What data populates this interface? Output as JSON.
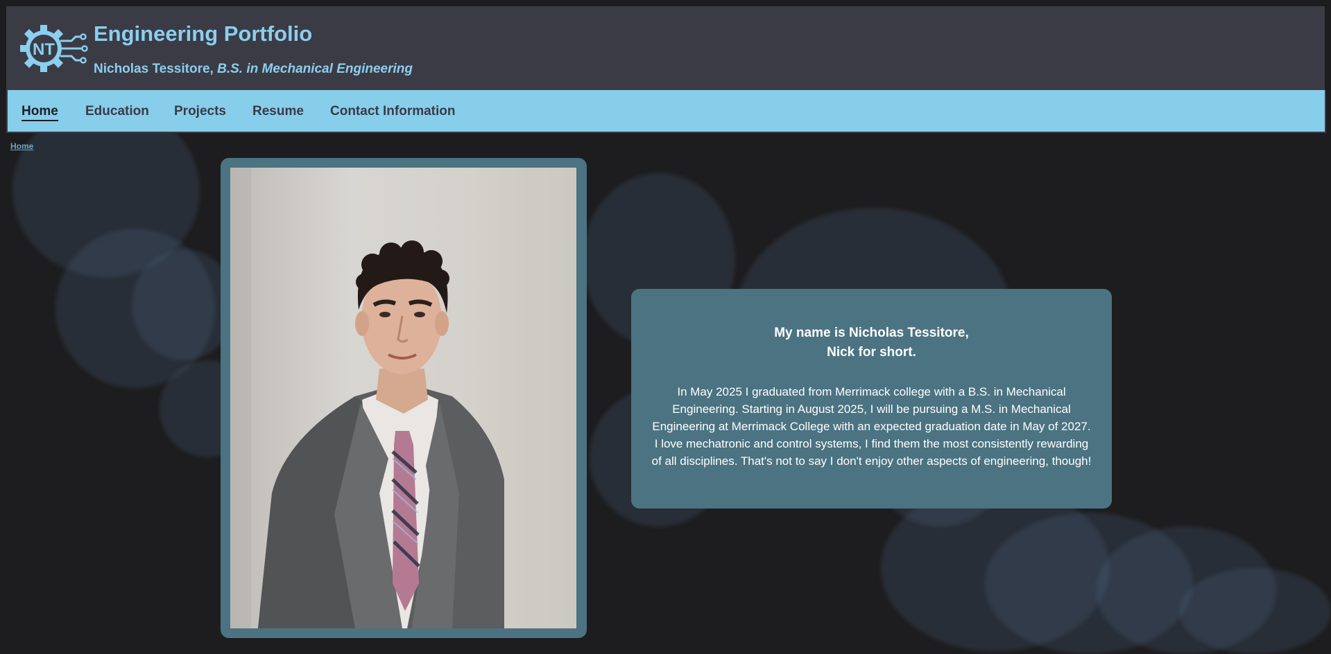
{
  "header": {
    "logo_text": "NT",
    "title": "Engineering Portfolio",
    "subtitle_name": "Nicholas Tessitore, ",
    "subtitle_degree": "B.S. in Mechanical Engineering"
  },
  "nav": {
    "items": [
      {
        "label": "Home",
        "active": true
      },
      {
        "label": "Education",
        "active": false
      },
      {
        "label": "Projects",
        "active": false
      },
      {
        "label": "Resume",
        "active": false
      },
      {
        "label": "Contact Information",
        "active": false
      }
    ]
  },
  "breadcrumb": {
    "current": "Home"
  },
  "intro": {
    "heading_line1": "My name is Nicholas Tessitore,",
    "heading_line2": "Nick for short.",
    "body": "In May 2025 I graduated from Merrimack college with a B.S. in Mechanical Engineering. Starting in August 2025, I will be pursuing a M.S. in Mechanical Engineering at Merrimack College with an expected graduation date in May of 2027. I love mechatronic and control systems, I find them the most consistently rewarding of all disciplines. That's not to say I don't enjoy other aspects of engineering, though!"
  },
  "colors": {
    "accent": "#87ceeb",
    "header_bg": "#3b3b46",
    "card_bg": "#4b7381",
    "page_bg": "#1d1d1f"
  }
}
